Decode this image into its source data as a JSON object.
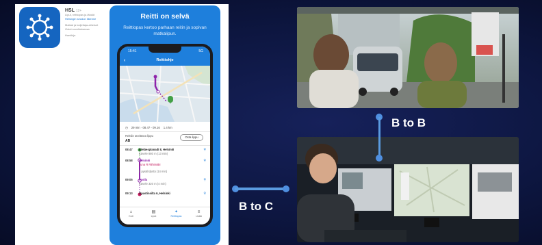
{
  "app_store": {
    "app_name": "HSL",
    "badge": "12+",
    "lines": [
      "Liput, reittiopas ja lähdöt",
      "Helsingin seudun liikenne",
      "Matkat ja kuljettaja-aiheiset",
      "Ostot sovelluksessa",
      "Hankkija"
    ]
  },
  "promo": {
    "title": "Reitti on selvä",
    "subtitle": "Reittiopas kertoo parhaan reitin ja sopivan matkalipun."
  },
  "phone": {
    "time": "15:41",
    "status_right": "5G",
    "nav_title": "Reittiohje",
    "back_icon": "‹",
    "trip": {
      "duration": "29 min · 08.47 - 09.16",
      "walk": "1.4 km"
    },
    "ticket_label": "Reittiin tarvittava lippu",
    "ticket_zone": "AB",
    "tickets_button": "Osta lippu",
    "stops": [
      {
        "time": "08:47",
        "name": "Eteläesplanadi 8, Helsinki",
        "detail": "Kävele 880 m (13 min)",
        "pink": false
      },
      {
        "time": "08:58",
        "name": "Helsinki",
        "detail": "Juna R Riihimäki",
        "pink": true
      },
      {
        "time": "",
        "name": "",
        "detail": "8 pysähdystä (14 min)",
        "pink": false
      },
      {
        "time": "09:05",
        "name": "Pasila",
        "detail": "Kävele 320 m (4 min)",
        "pink": false
      },
      {
        "time": "09:13",
        "name": "Opastinsilta 6, Helsinki",
        "detail": "",
        "pink": false
      }
    ],
    "tabs": [
      {
        "label": "Koti",
        "icon": "home-icon",
        "glyph": "⌂",
        "active": false
      },
      {
        "label": "Liput",
        "icon": "ticket-icon",
        "glyph": "▤",
        "active": false
      },
      {
        "label": "Reittiopas",
        "icon": "route-icon",
        "glyph": "✦",
        "active": true
      },
      {
        "label": "Lisää",
        "icon": "menu-icon",
        "glyph": "≡",
        "active": false
      }
    ]
  },
  "labels": {
    "b_to_b": "B to B",
    "b_to_c": "B to C"
  },
  "colors": {
    "background": "#0d1640",
    "hsl_blue": "#1e7fdc",
    "connector": "#5a9be0",
    "route_purple": "#8e24aa",
    "pin_green": "#43a047"
  }
}
